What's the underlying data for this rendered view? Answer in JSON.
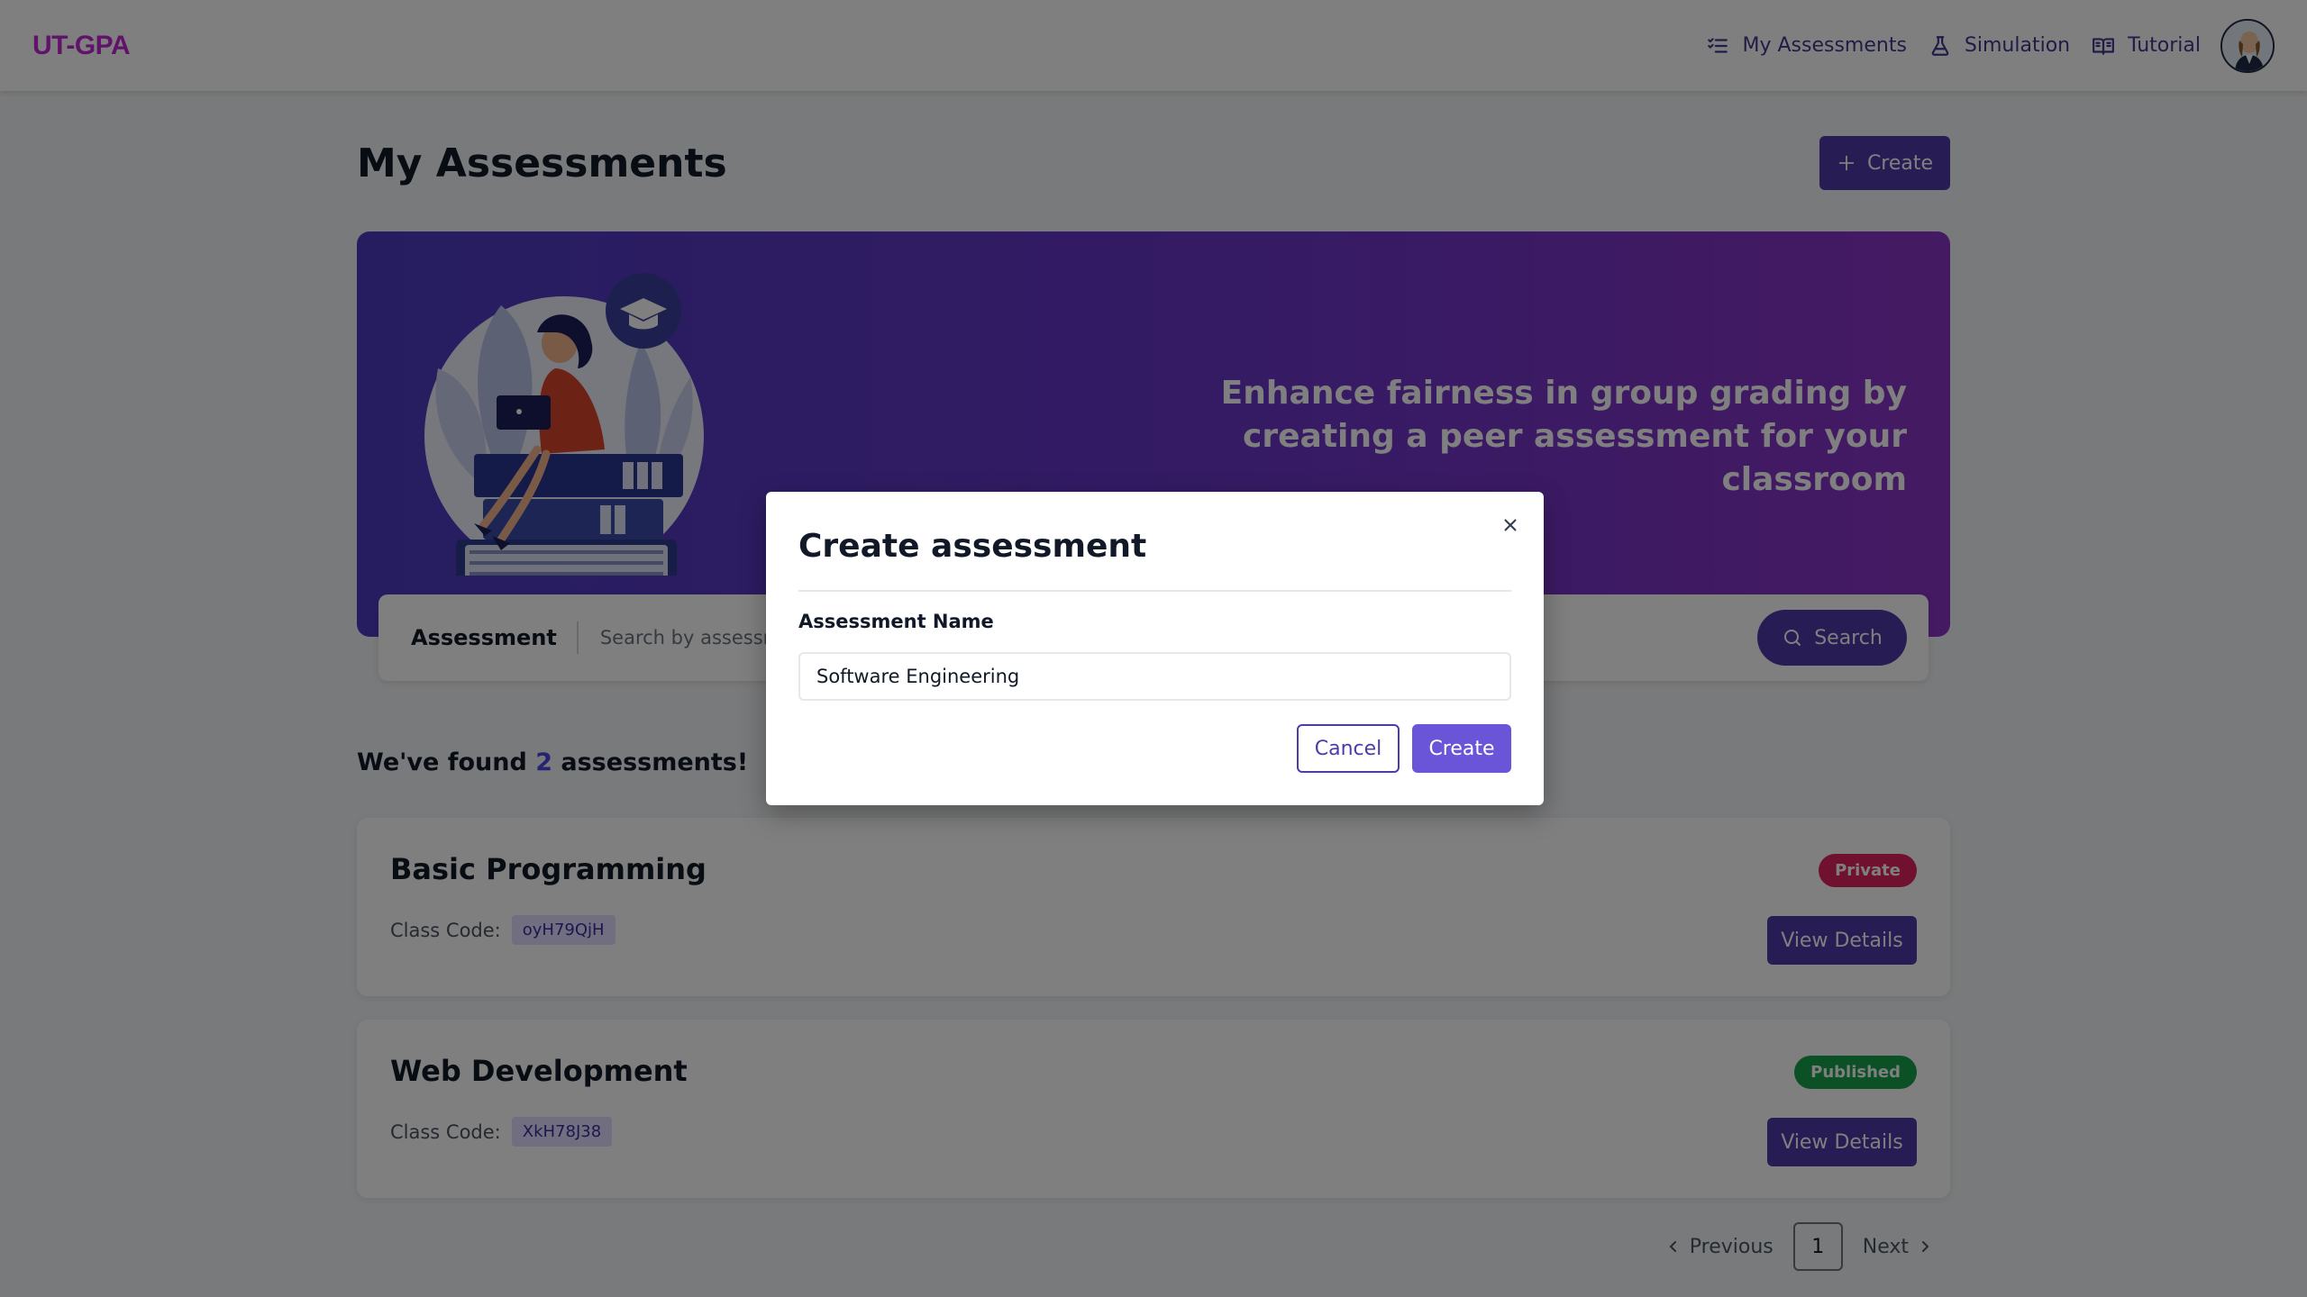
{
  "brand": {
    "logo": "UT-GPA"
  },
  "nav": {
    "my_assessments": "My Assessments",
    "simulation": "Simulation",
    "tutorial": "Tutorial"
  },
  "page": {
    "title": "My Assessments",
    "create_button": "Create"
  },
  "hero": {
    "tagline": "Enhance fairness in group grading by creating a peer assessment for your classroom"
  },
  "search": {
    "label": "Assessment",
    "placeholder": "Search by assessment name",
    "button": "Search"
  },
  "results": {
    "prefix": "We've found",
    "count": "2",
    "suffix": "assessments!"
  },
  "assessments": [
    {
      "name": "Basic Programming",
      "code_label": "Class Code:",
      "code": "oyH79QjH",
      "status": "Private",
      "button": "View Details"
    },
    {
      "name": "Web Development",
      "code_label": "Class Code:",
      "code": "XkH78J38",
      "status": "Published",
      "button": "View Details"
    }
  ],
  "pagination": {
    "previous": "Previous",
    "current": "1",
    "next": "Next"
  },
  "modal": {
    "title": "Create assessment",
    "field_label": "Assessment Name",
    "field_value": "Software Engineering",
    "cancel": "Cancel",
    "create": "Create"
  },
  "colors": {
    "primary": "#4f3aa8",
    "brand_logo": "#c026d3",
    "private_badge": "#e0245e",
    "published_badge": "#16a34a"
  },
  "icons": {
    "my_assessments": "checklist-icon",
    "simulation": "flask-icon",
    "tutorial": "book-open-icon",
    "create": "plus-icon",
    "search": "search-icon",
    "close": "close-icon",
    "prev": "chevron-left-icon",
    "next": "chevron-right-icon"
  }
}
